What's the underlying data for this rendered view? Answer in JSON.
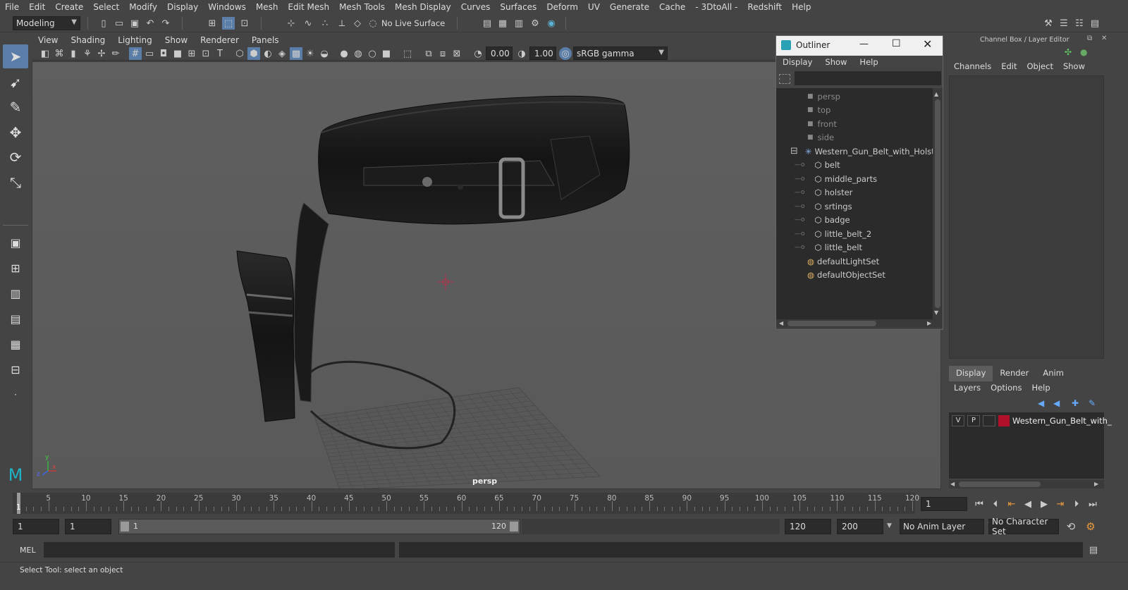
{
  "menubar": [
    "File",
    "Edit",
    "Create",
    "Select",
    "Modify",
    "Display",
    "Windows",
    "Mesh",
    "Edit Mesh",
    "Mesh Tools",
    "Mesh Display",
    "Curves",
    "Surfaces",
    "Deform",
    "UV",
    "Generate",
    "Cache",
    "- 3DtoAll -",
    "Redshift",
    "Help"
  ],
  "shelf": {
    "mode": "Modeling",
    "live_surface": "No Live Surface"
  },
  "viewport": {
    "menu": [
      "View",
      "Shading",
      "Lighting",
      "Show",
      "Renderer",
      "Panels"
    ],
    "exposure": "0.00",
    "gamma": "1.00",
    "color_space": "sRGB gamma",
    "camera_label": "persp",
    "axis": {
      "x": "x",
      "y": "y",
      "z": "z"
    }
  },
  "outliner": {
    "title": "Outliner",
    "menu": [
      "Display",
      "Show",
      "Help"
    ],
    "cameras": [
      "persp",
      "top",
      "front",
      "side"
    ],
    "group": "Western_Gun_Belt_with_Holster",
    "children": [
      "belt",
      "middle_parts",
      "holster",
      "srtings",
      "badge",
      "little_belt_2",
      "little_belt"
    ],
    "sets": [
      "defaultLightSet",
      "defaultObjectSet"
    ]
  },
  "channelbox": {
    "header": "Channel Box / Layer Editor",
    "menu": [
      "Channels",
      "Edit",
      "Object",
      "Show"
    ],
    "tabs": [
      "Display",
      "Render",
      "Anim"
    ],
    "layer_menu": [
      "Layers",
      "Options",
      "Help"
    ],
    "layer": {
      "v": "V",
      "p": "P",
      "name": "Western_Gun_Belt_with_",
      "color": "#b0102a"
    }
  },
  "timeline": {
    "ticks": [
      "1",
      "5",
      "10",
      "15",
      "20",
      "25",
      "30",
      "35",
      "40",
      "45",
      "50",
      "55",
      "60",
      "65",
      "70",
      "75",
      "80",
      "85",
      "90",
      "95",
      "100",
      "105",
      "110",
      "115",
      "120"
    ],
    "current_frame": "1"
  },
  "range": {
    "start": "1",
    "playback_start": "1",
    "slider_start": "1",
    "slider_end": "120",
    "playback_end": "120",
    "end": "200",
    "anim_layer": "No Anim Layer",
    "char_set": "No Character Set"
  },
  "mel": {
    "label": "MEL"
  },
  "status": {
    "text": "Select Tool: select an object"
  }
}
